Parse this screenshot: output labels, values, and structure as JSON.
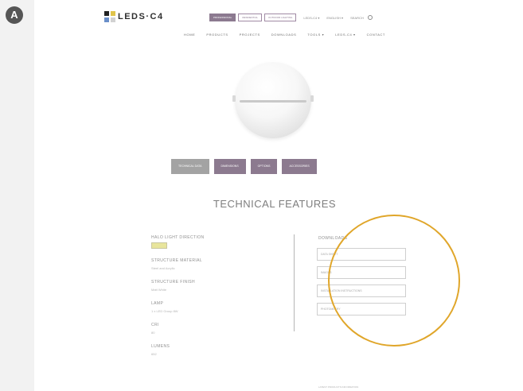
{
  "figure_label": "A",
  "header": {
    "brand": "LEDS·C4",
    "top_buttons": [
      {
        "label": "PROFESSIONAL",
        "style": "filled"
      },
      {
        "label": "RESIDENTIAL",
        "style": "outline"
      },
      {
        "label": "OUTDOOR LIGHTING",
        "style": "outline"
      }
    ],
    "top_links": [
      "LEDS-C4 ▾",
      "ENGLISH ▾",
      "SEARCH"
    ],
    "nav": [
      "HOME",
      "PRODUCTS",
      "PROJECTS",
      "DOWNLOADS",
      "TOOLS ▾",
      "LEDS-C4 ▾",
      "CONTACT"
    ]
  },
  "tabs": [
    {
      "label": "TECHNICAL DATA",
      "active": true
    },
    {
      "label": "DIMENSIONS",
      "active": false
    },
    {
      "label": "OPTIONS",
      "active": false
    },
    {
      "label": "ACCESSORIES",
      "active": false
    }
  ],
  "section_title": "TECHNICAL FEATURES",
  "features": [
    {
      "label": "HALO LIGHT DIRECTION",
      "value": "",
      "icon": "halo-direction-icon"
    },
    {
      "label": "STRUCTURE MATERIAL",
      "value": "Steel and Acrylic"
    },
    {
      "label": "STRUCTURE FINISH",
      "value": "Matt White"
    },
    {
      "label": "LAMP",
      "value": "1 x LED Group 8W"
    },
    {
      "label": "CRI",
      "value": "80"
    },
    {
      "label": "LUMENS",
      "value": "652"
    }
  ],
  "downloads": {
    "heading": "DOWNLOADS",
    "items": [
      "DATA SHEET",
      "IMAGES",
      "INSTALLATION INSTRUCTIONS",
      "PHOTOMETRY"
    ]
  },
  "footnote": "LATEST PRODUCTS INFORMATION",
  "colors": {
    "accent_purple": "#8c7a8f",
    "highlight_circle": "#e0a62a",
    "badge": "#555555"
  }
}
